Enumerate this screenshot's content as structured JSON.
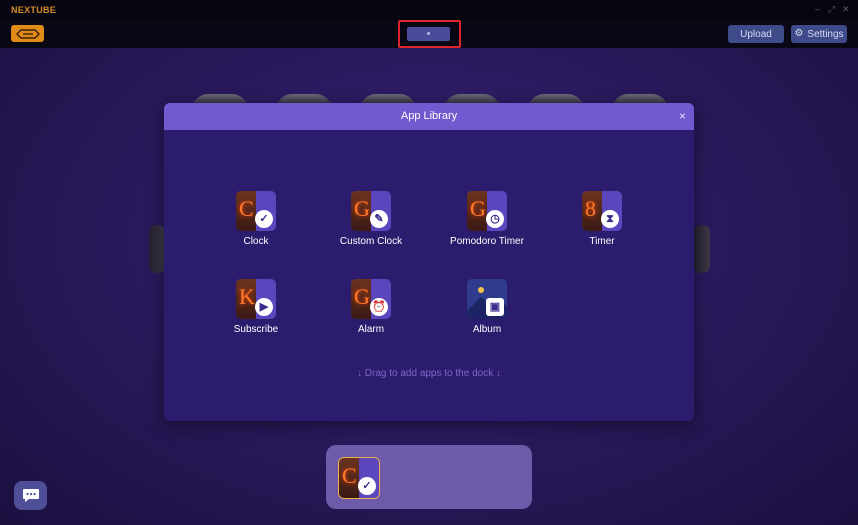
{
  "app": {
    "brand": "NEXTUBE",
    "window_controls": [
      "–",
      "⤢",
      "✕"
    ]
  },
  "toolbar": {
    "logo_icon": "tube-logo-icon",
    "upload_label": "Upload",
    "settings_label": "Settings",
    "settings_icon": "gear-icon"
  },
  "modal": {
    "title": "App Library",
    "close_glyph": "×",
    "hint": "↓ Drag to add apps to the dock ↓",
    "apps": [
      {
        "label": "Clock",
        "glyph": "C",
        "badge": "✓",
        "icon": "clock-app-icon"
      },
      {
        "label": "Custom Clock",
        "glyph": "G",
        "badge": "✎",
        "icon": "custom-clock-app-icon"
      },
      {
        "label": "Pomodoro Timer",
        "glyph": "G",
        "badge": "◷",
        "icon": "pomodoro-app-icon"
      },
      {
        "label": "Timer",
        "glyph": "8",
        "badge": "⧗",
        "icon": "timer-app-icon"
      },
      {
        "label": "Subscribe",
        "glyph": "K",
        "badge": "▶",
        "icon": "subscribe-app-icon"
      },
      {
        "label": "Alarm",
        "glyph": "G",
        "badge": "⏰",
        "icon": "alarm-app-icon"
      },
      {
        "label": "Album",
        "glyph": "",
        "badge": "▣",
        "icon": "album-app-icon"
      }
    ]
  },
  "dock": {
    "items": [
      {
        "glyph": "C",
        "badge": "✓",
        "icon": "clock-app-icon"
      }
    ]
  },
  "colors": {
    "accent": "#7259cf",
    "brand": "#d98c2b",
    "highlight": "#e0252b"
  }
}
